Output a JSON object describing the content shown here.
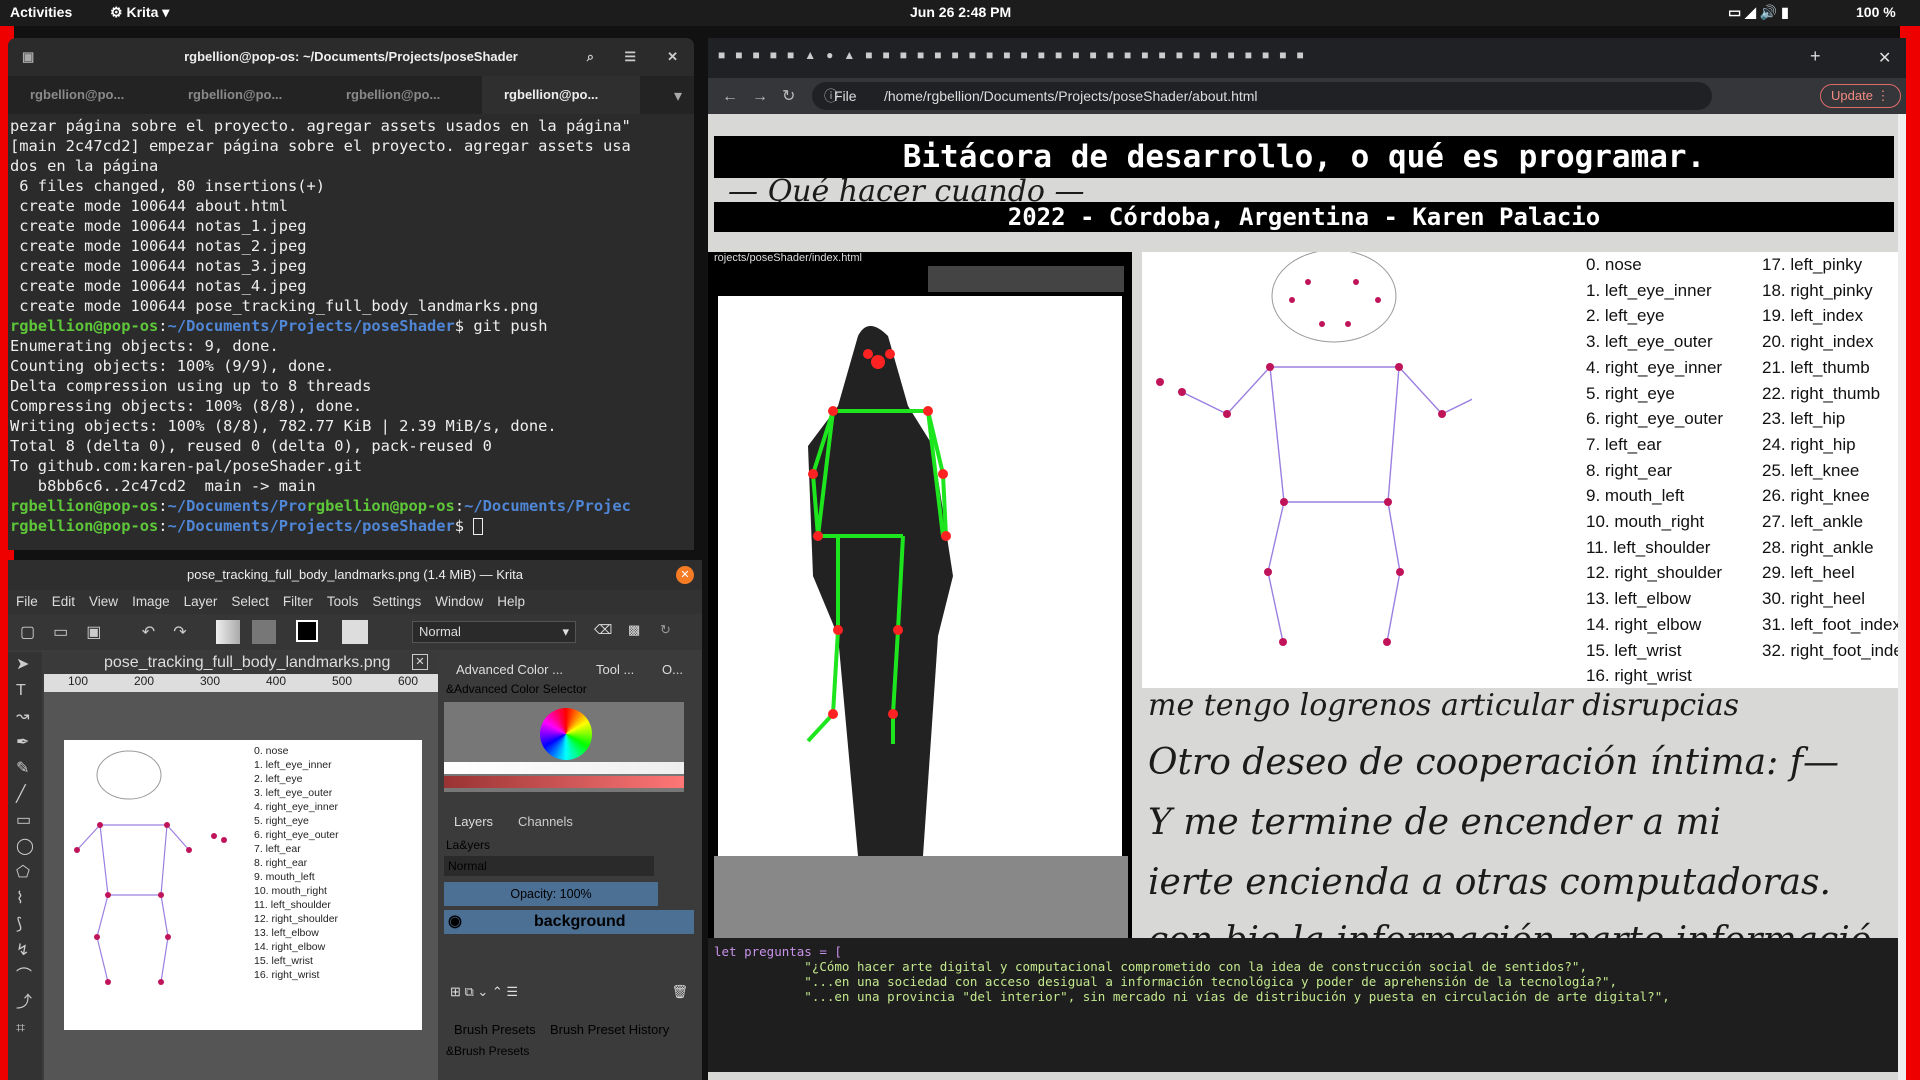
{
  "topbar": {
    "activities": "Activities",
    "app": "Krita",
    "clock": "Jun 26  2:48 PM",
    "battery": "100 %"
  },
  "terminal": {
    "title": "rgbellion@pop-os: ~/Documents/Projects/poseShader",
    "tabs": [
      "rgbellion@po...",
      "rgbellion@po...",
      "rgbellion@po...",
      "rgbellion@po..."
    ],
    "lines": [
      {
        "t": "pezar página sobre el proyecto. agregar assets usados en la página\""
      },
      {
        "t": "[main 2c47cd2] empezar página sobre el proyecto. agregar assets usa"
      },
      {
        "t": "dos en la página"
      },
      {
        "t": " 6 files changed, 80 insertions(+)"
      },
      {
        "t": " create mode 100644 about.html"
      },
      {
        "t": " create mode 100644 notas_1.jpeg"
      },
      {
        "t": " create mode 100644 notas_2.jpeg"
      },
      {
        "t": " create mode 100644 notas_3.jpeg"
      },
      {
        "t": " create mode 100644 notas_4.jpeg"
      },
      {
        "t": " create mode 100644 pose_tracking_full_body_landmarks.png"
      }
    ],
    "prompt_user": "rgbellion@pop-os",
    "prompt_path": "~/Documents/Projects/poseShader",
    "cmd": "$ git push",
    "lines2": [
      "Enumerating objects: 9, done.",
      "Counting objects: 100% (9/9), done.",
      "Delta compression using up to 8 threads",
      "Compressing objects: 100% (8/8), done.",
      "Writing objects: 100% (8/8), 782.77 KiB | 2.39 MiB/s, done.",
      "Total 8 (delta 0), reused 0 (delta 0), pack-reused 0",
      "To github.com:karen-pal/poseShader.git",
      "   b8bb6c6..2c47cd2  main -> main"
    ],
    "mix_a": "~/Documents/Pro",
    "mix_b": "~/Documents/Projec"
  },
  "krita": {
    "title": "pose_tracking_full_body_landmarks.png (1.4 MiB) — Krita",
    "menu": [
      "File",
      "Edit",
      "View",
      "Image",
      "Layer",
      "Select",
      "Filter",
      "Tools",
      "Settings",
      "Window",
      "Help"
    ],
    "blend": "Normal",
    "doc_tab": "pose_tracking_full_body_landmarks.png",
    "ruler": [
      "100",
      "200",
      "300",
      "400",
      "500",
      "600"
    ],
    "dock_tabs": [
      "Advanced Color ...",
      "Tool ...",
      "O..."
    ],
    "color_selector": "&Advanced Color Selector",
    "layers_tab": "Layers",
    "channels_tab": "Channels",
    "layers_label": "La&yers",
    "layer_blend": "Normal",
    "opacity": "Opacity:  100%",
    "layer_name": "background",
    "brush_tabs": [
      "Brush Presets",
      "Brush Preset History"
    ],
    "brush_label": "&Brush Presets"
  },
  "browser": {
    "file_label": "File",
    "url": "/home/rgbellion/Documents/Projects/poseShader/about.html",
    "update": "Update",
    "h1": "Bitácora de desarrollo, o qué es programar.",
    "h2": "2022 - Córdoba, Argentina - Karen Palacio",
    "vid_url": "rojects/poseShader/index.html",
    "code_lines": [
      "let preguntas = [",
      "            \"¿Cómo hacer arte digital y computacional comprometido con la idea de construcción social de sentidos?\",",
      "            \"...en una sociedad con acceso desigual a información tecnológica y poder de aprehensión de la tecnología?\",",
      "            \"...en una provincia \"del interior\", sin mercado ni vías de distribución y puesta en circulación de arte digital?\","
    ],
    "handwriting": [
      "me tengo logrenos articular disrupcias",
      "Otro deseo de cooperación íntima: f—",
      "Y me termine de encender a mi",
      "ierte encienda a otras computadoras.",
      "con bie la información parte informació"
    ]
  },
  "landmarks": [
    "0. nose",
    "1. left_eye_inner",
    "2. left_eye",
    "3. left_eye_outer",
    "4. right_eye_inner",
    "5. right_eye",
    "6. right_eye_outer",
    "7. left_ear",
    "8. right_ear",
    "9. mouth_left",
    "10. mouth_right",
    "11. left_shoulder",
    "12. right_shoulder",
    "13. left_elbow",
    "14. right_elbow",
    "15. left_wrist",
    "16. right_wrist",
    "17. left_pinky",
    "18. right_pinky",
    "19. left_index",
    "20. right_index",
    "21. left_thumb",
    "22. right_thumb",
    "23. left_hip",
    "24. right_hip",
    "25. left_knee",
    "26. right_knee",
    "27. left_ankle",
    "28. right_ankle",
    "29. left_heel",
    "30. right_heel",
    "31. left_foot_index",
    "32. right_foot_inde"
  ]
}
